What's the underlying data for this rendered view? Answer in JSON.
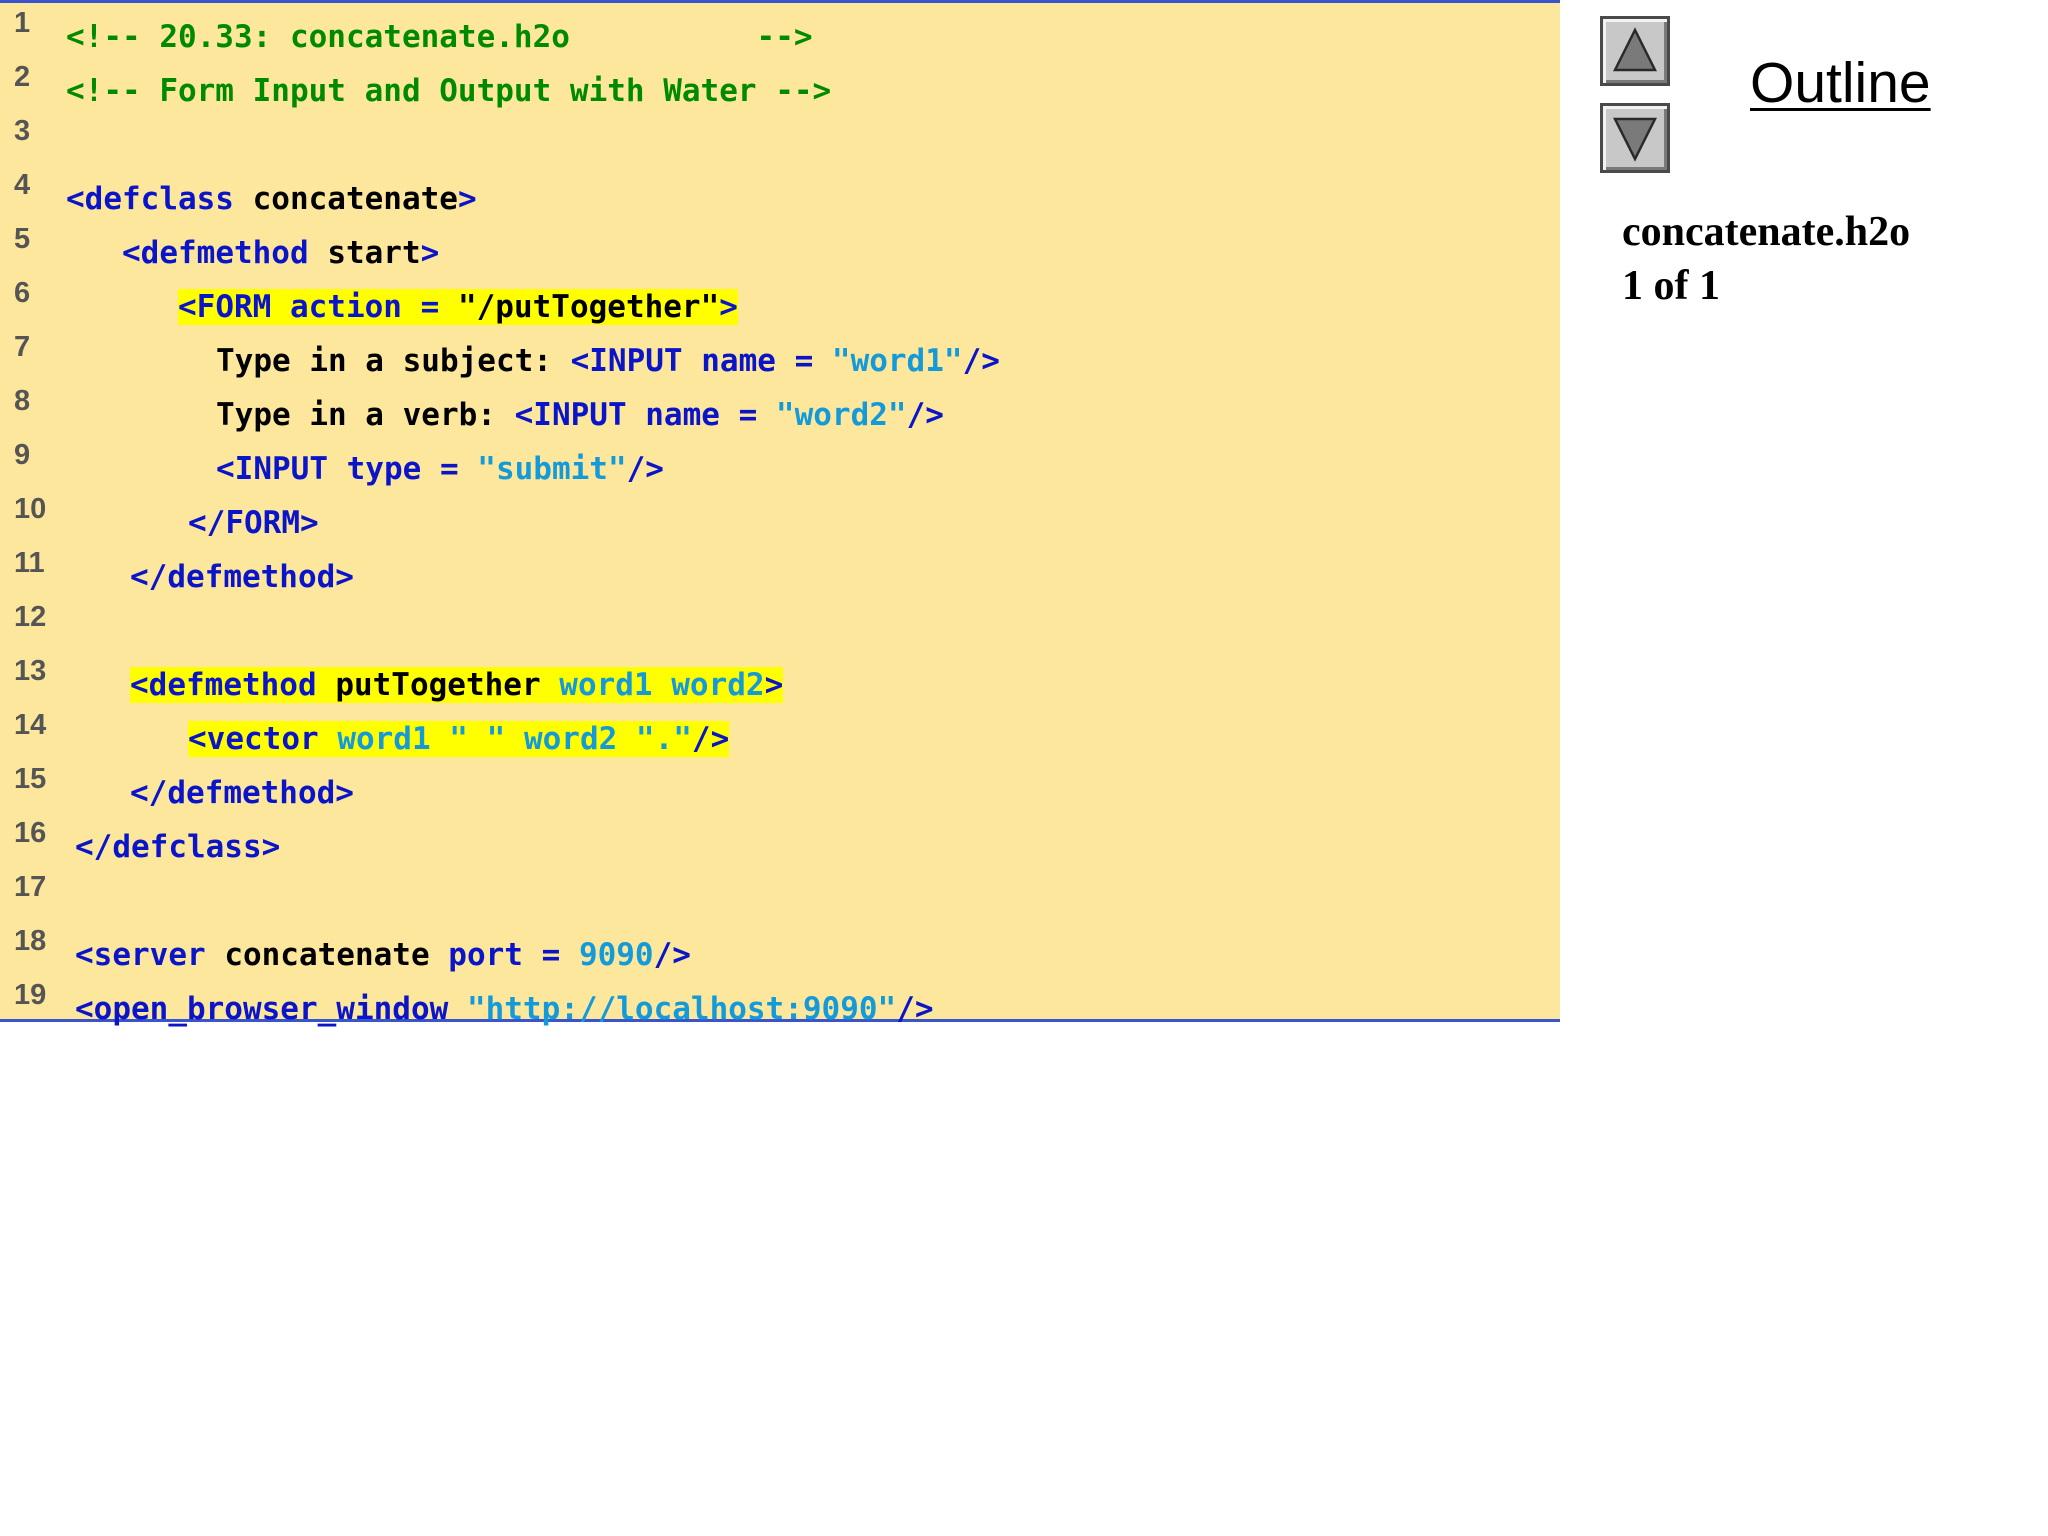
{
  "code": {
    "lines": [
      {
        "num": "1",
        "segments": [
          {
            "t": "<!-- 20.33: concatenate.h2o          -->",
            "c": "com"
          }
        ]
      },
      {
        "num": "2",
        "segments": [
          {
            "t": "<!-- Form Input and Output with Water -->",
            "c": "com"
          }
        ]
      },
      {
        "num": "3",
        "segments": []
      },
      {
        "num": "4",
        "segments": [
          {
            "t": "<defclass ",
            "c": "tag"
          },
          {
            "t": "concatenate",
            "c": "txt"
          },
          {
            "t": ">",
            "c": "tag"
          }
        ]
      },
      {
        "num": "5",
        "segments": [
          {
            "t": "<defmethod ",
            "c": "tag"
          },
          {
            "t": "start",
            "c": "txt"
          },
          {
            "t": ">",
            "c": "tag"
          }
        ]
      },
      {
        "num": "6",
        "segments": [
          {
            "t": "<FORM action = ",
            "c": "tag",
            "hl": true
          },
          {
            "t": "\"/putTogether\"",
            "c": "txt",
            "hl": true
          },
          {
            "t": ">",
            "c": "tag",
            "hl": true
          }
        ]
      },
      {
        "num": "7",
        "segments": [
          {
            "t": "Type in a subject: ",
            "c": "txt"
          },
          {
            "t": "<INPUT name = ",
            "c": "tag"
          },
          {
            "t": "\"word1\"",
            "c": "str"
          },
          {
            "t": "/>",
            "c": "tag"
          }
        ]
      },
      {
        "num": "8",
        "segments": [
          {
            "t": "Type in a verb: ",
            "c": "txt"
          },
          {
            "t": "<INPUT name = ",
            "c": "tag"
          },
          {
            "t": "\"word2\"",
            "c": "str"
          },
          {
            "t": "/>",
            "c": "tag"
          }
        ]
      },
      {
        "num": "9",
        "segments": [
          {
            "t": "<INPUT type = ",
            "c": "tag"
          },
          {
            "t": "\"submit\"",
            "c": "str"
          },
          {
            "t": "/>",
            "c": "tag"
          }
        ]
      },
      {
        "num": "10",
        "segments": [
          {
            "t": "</FORM>",
            "c": "tag"
          }
        ]
      },
      {
        "num": "11",
        "segments": [
          {
            "t": "</defmethod>",
            "c": "tag"
          }
        ]
      },
      {
        "num": "12",
        "segments": []
      },
      {
        "num": "13",
        "segments": [
          {
            "t": "<defmethod ",
            "c": "tag",
            "hl": true
          },
          {
            "t": "putTogether ",
            "c": "txt",
            "hl": true
          },
          {
            "t": "word1 word2",
            "c": "str",
            "hl": true
          },
          {
            "t": ">",
            "c": "tag",
            "hl": true
          }
        ]
      },
      {
        "num": "14",
        "segments": [
          {
            "t": "<vector ",
            "c": "tag",
            "hl": true
          },
          {
            "t": "word1 \" \" word2 \".\"",
            "c": "str",
            "hl": true
          },
          {
            "t": "/>",
            "c": "tag",
            "hl": true
          }
        ]
      },
      {
        "num": "15",
        "segments": [
          {
            "t": "</defmethod>",
            "c": "tag"
          }
        ]
      },
      {
        "num": "16",
        "segments": [
          {
            "t": "</defclass>",
            "c": "tag"
          }
        ]
      },
      {
        "num": "17",
        "segments": []
      },
      {
        "num": "18",
        "segments": [
          {
            "t": "<server ",
            "c": "tag"
          },
          {
            "t": "concatenate ",
            "c": "txt"
          },
          {
            "t": "port = ",
            "c": "tag"
          },
          {
            "t": "9090",
            "c": "str"
          },
          {
            "t": "/>",
            "c": "tag"
          }
        ]
      },
      {
        "num": "19",
        "segments": [
          {
            "t": "<open_browser_window ",
            "c": "tag"
          },
          {
            "t": "\"http://localhost:9090\"",
            "c": "str"
          },
          {
            "t": "/>",
            "c": "tag"
          }
        ]
      }
    ]
  },
  "sidebar": {
    "outline_label": "Outline",
    "file_name": "concatenate.h2o",
    "page_indicator": "1 of 1",
    "up_icon": "triangle-up-icon",
    "down_icon": "triangle-down-icon"
  },
  "colors": {
    "panel_background": "#fde79c",
    "panel_border": "#3a55cc",
    "comment": "#008a00",
    "tag": "#0a14c8",
    "text": "#000000",
    "string": "#159ad9",
    "highlight": "#ffff00"
  }
}
